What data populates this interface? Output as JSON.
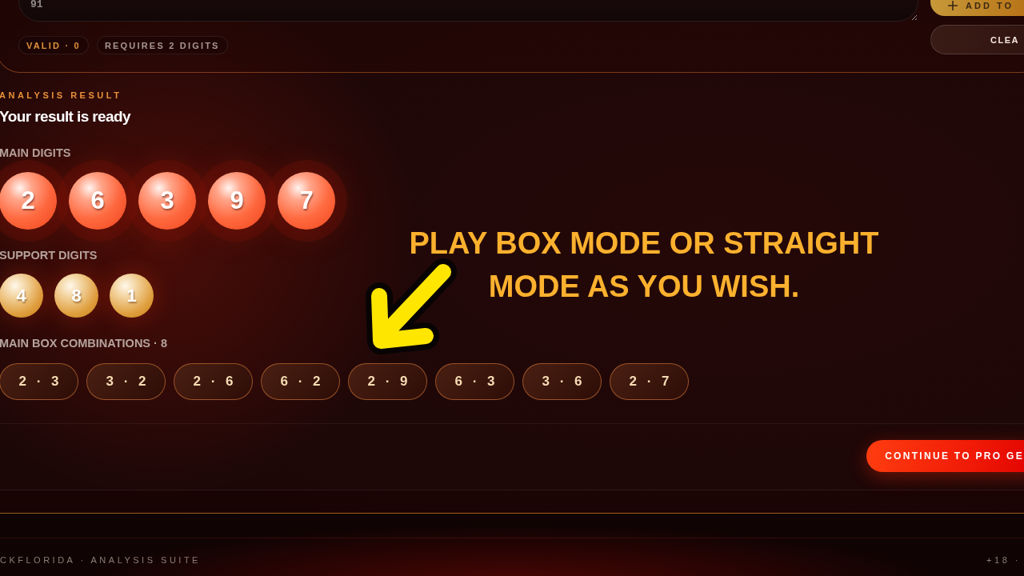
{
  "input_panel": {
    "textarea": {
      "value": "91"
    },
    "buttons": [
      {
        "kind": "primary",
        "label": "ADD TO"
      },
      {
        "kind": "secondary",
        "label": "CLEA"
      }
    ],
    "chips": [
      {
        "kind": "valid",
        "label": "VALID · 0"
      },
      {
        "kind": "hint",
        "label": "REQUIRES 2 DIGITS"
      }
    ]
  },
  "result": {
    "eyebrow": "ANALYSIS RESULT",
    "title": "Your result is ready",
    "main_digits": {
      "label": "MAIN DIGITS",
      "digits": [
        "2",
        "6",
        "3",
        "9",
        "7"
      ]
    },
    "support_digits": {
      "label": "SUPPORT DIGITS",
      "digits": [
        "4",
        "8",
        "1"
      ]
    },
    "combinations": {
      "label": "MAIN BOX COMBINATIONS · 8",
      "items": [
        "2 · 3",
        "3 · 2",
        "2 · 6",
        "6 · 2",
        "2 · 9",
        "6 · 3",
        "3 · 6",
        "2 · 7"
      ]
    }
  },
  "actions": {
    "continue_button": "CONTINUE TO PRO GE"
  },
  "footer": {
    "left": "CKFLORIDA · ANALYSIS SUITE",
    "right": "+18 ·"
  },
  "annotation": {
    "text": "PLAY BOX MODE OR STRAIGHT MODE AS YOU WISH."
  }
}
